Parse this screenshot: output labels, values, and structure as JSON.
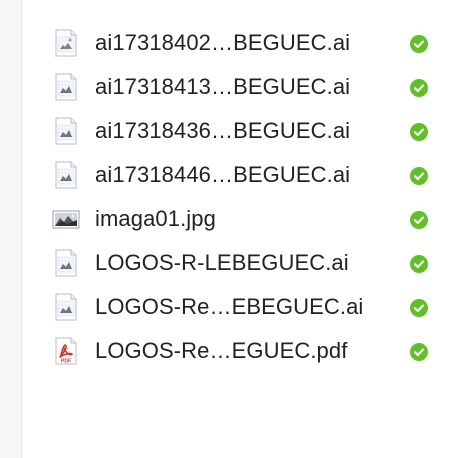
{
  "files": [
    {
      "name": "ai17318402…BEGUEC.ai",
      "type": "ai-file-icon",
      "status": "synced-check-icon"
    },
    {
      "name": "ai17318413…BEGUEC.ai",
      "type": "ai-file-icon",
      "status": "synced-check-icon"
    },
    {
      "name": "ai17318436…BEGUEC.ai",
      "type": "ai-file-icon",
      "status": "synced-check-icon"
    },
    {
      "name": "ai17318446…BEGUEC.ai",
      "type": "ai-file-icon",
      "status": "synced-check-icon"
    },
    {
      "name": "imaga01.jpg",
      "type": "image-file-icon",
      "status": "synced-check-icon"
    },
    {
      "name": "LOGOS-R-LEBEGUEC.ai",
      "type": "ai-file-icon",
      "status": "synced-check-icon"
    },
    {
      "name": "LOGOS-Re…EBEGUEC.ai",
      "type": "ai-file-icon",
      "status": "synced-check-icon"
    },
    {
      "name": "LOGOS-Re…EGUEC.pdf",
      "type": "pdf-file-icon",
      "status": "synced-check-icon",
      "badge": "PDF"
    }
  ],
  "colors": {
    "status_green": "#60c127",
    "pdf_red": "#d9322b",
    "text": "#222222"
  }
}
